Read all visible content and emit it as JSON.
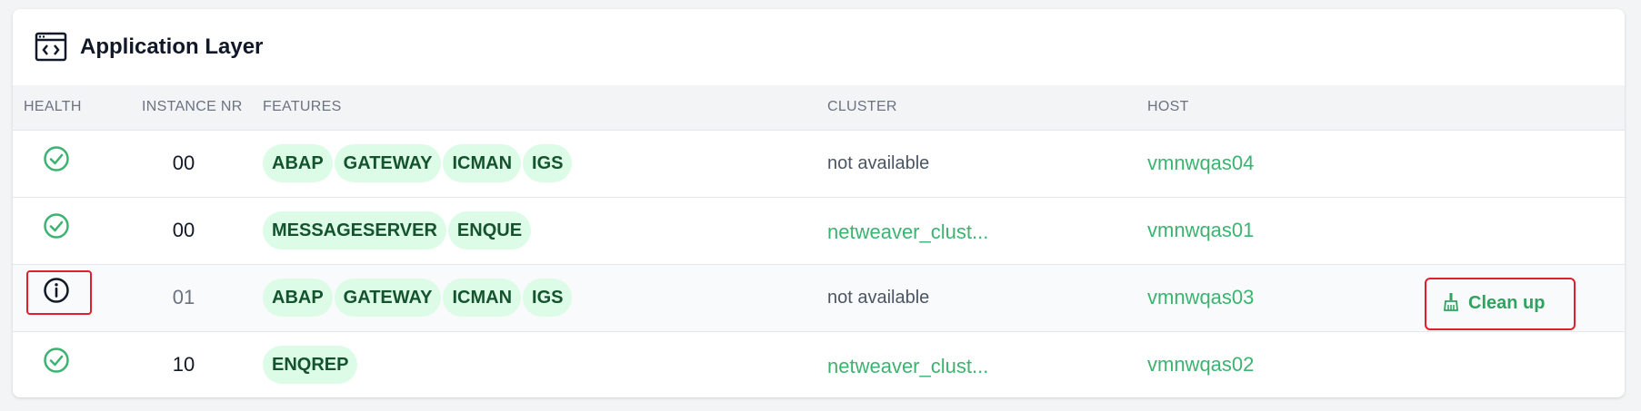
{
  "card": {
    "title": "Application Layer",
    "title_icon": "code-window-icon"
  },
  "table": {
    "columns": [
      "HEALTH",
      "INSTANCE NR",
      "FEATURES",
      "CLUSTER",
      "HOST"
    ],
    "rows": [
      {
        "health": "passing",
        "health_icon": "check-circle-icon",
        "instance_nr": "00",
        "features": [
          "ABAP",
          "GATEWAY",
          "ICMAN",
          "IGS"
        ],
        "cluster": "not available",
        "host": "vmnwqas04"
      },
      {
        "health": "passing",
        "health_icon": "check-circle-icon",
        "instance_nr": "00",
        "features": [
          "MESSAGESERVER",
          "ENQUE"
        ],
        "cluster": "netweaver_clust...",
        "host": "vmnwqas01"
      },
      {
        "health": "unknown",
        "health_icon": "info-circle-icon",
        "instance_nr": "01",
        "features": [
          "ABAP",
          "GATEWAY",
          "ICMAN",
          "IGS"
        ],
        "cluster": "not available",
        "host": "vmnwqas03",
        "action": {
          "label": "Clean up",
          "icon": "broom-icon"
        }
      },
      {
        "health": "passing",
        "health_icon": "check-circle-icon",
        "instance_nr": "10",
        "features": [
          "ENQREP"
        ],
        "cluster": "netweaver_clust...",
        "host": "vmnwqas02"
      }
    ]
  },
  "colors": {
    "accent_green": "#3cb371",
    "pill_bg": "#dcfce7",
    "pill_text": "#14532d",
    "highlight_red": "#e11d2e"
  }
}
